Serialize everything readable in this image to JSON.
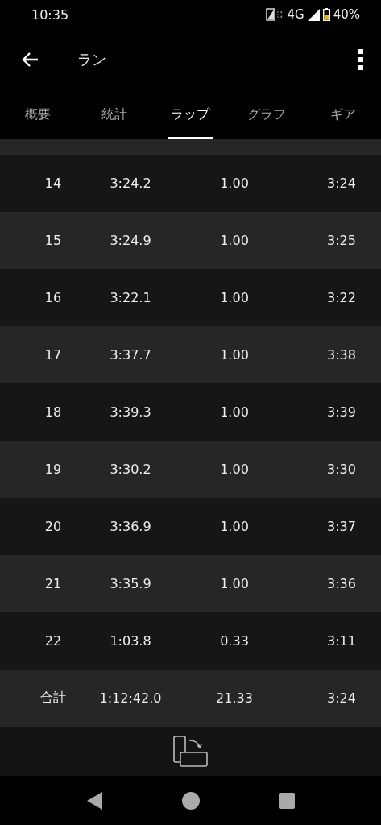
{
  "status_bar": {
    "time": "10:35",
    "network": "4G",
    "battery": "40%"
  },
  "app_bar": {
    "title": "ラン"
  },
  "tabs": [
    {
      "label": "概要",
      "selected": false
    },
    {
      "label": "統計",
      "selected": false
    },
    {
      "label": "ラップ",
      "selected": true
    },
    {
      "label": "グラフ",
      "selected": false
    },
    {
      "label": "ギア",
      "selected": false
    }
  ],
  "laps": [
    [
      "14",
      "3:24.2",
      "1.00",
      "3:24"
    ],
    [
      "15",
      "3:24.9",
      "1.00",
      "3:25"
    ],
    [
      "16",
      "3:22.1",
      "1.00",
      "3:22"
    ],
    [
      "17",
      "3:37.7",
      "1.00",
      "3:38"
    ],
    [
      "18",
      "3:39.3",
      "1.00",
      "3:39"
    ],
    [
      "19",
      "3:30.2",
      "1.00",
      "3:30"
    ],
    [
      "20",
      "3:36.9",
      "1.00",
      "3:37"
    ],
    [
      "21",
      "3:35.9",
      "1.00",
      "3:36"
    ],
    [
      "22",
      "1:03.8",
      "0.33",
      "3:11"
    ]
  ],
  "total": [
    "合計",
    "1:12:42.0",
    "21.33",
    "3:24"
  ]
}
